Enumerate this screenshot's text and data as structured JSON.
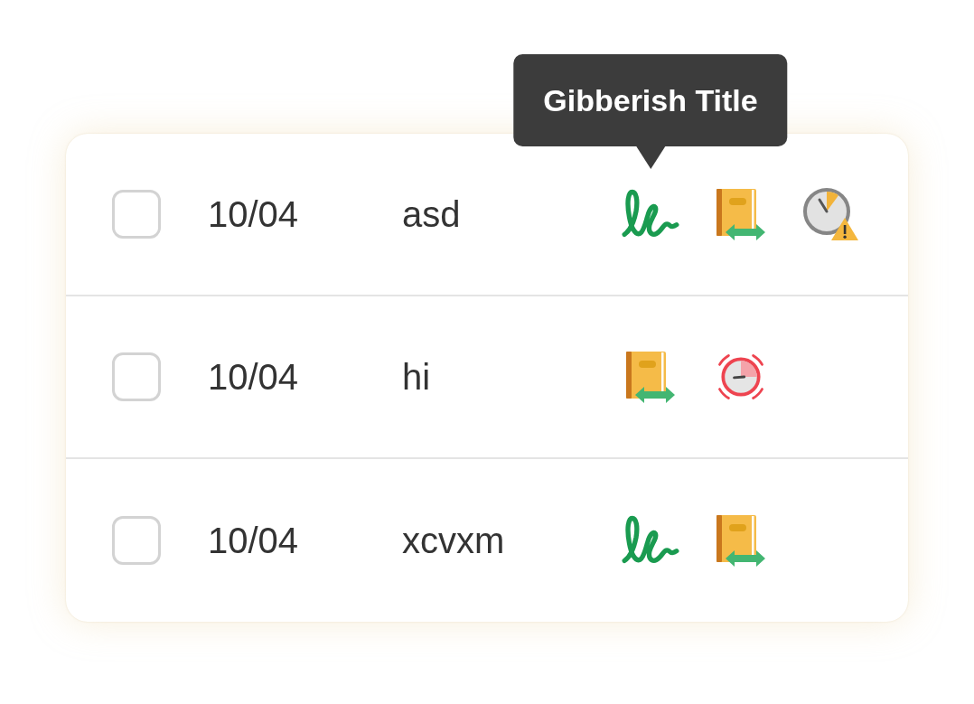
{
  "rows": [
    {
      "checked": false,
      "date": "10/04",
      "name": "asd",
      "icons": [
        {
          "kind": "signature",
          "tooltip": "Gibberish Title"
        },
        {
          "kind": "book-transfer"
        },
        {
          "kind": "clock-warning"
        }
      ]
    },
    {
      "checked": false,
      "date": "10/04",
      "name": "hi",
      "icons": [
        {
          "kind": "book-transfer"
        },
        {
          "kind": "alarm"
        }
      ]
    },
    {
      "checked": false,
      "date": "10/04",
      "name": "xcvxm",
      "icons": [
        {
          "kind": "signature"
        },
        {
          "kind": "book-transfer"
        }
      ]
    }
  ]
}
